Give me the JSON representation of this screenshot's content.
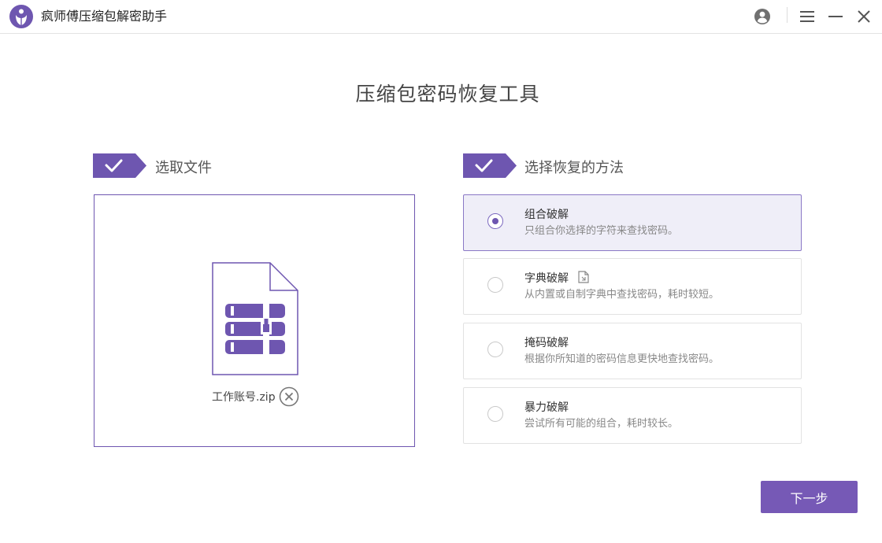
{
  "app": {
    "title": "疯师傅压缩包解密助手",
    "colors": {
      "accent": "#6e56b0",
      "button": "#7659b6",
      "selected_bg": "#efeef8"
    }
  },
  "titlebar": {
    "icons": [
      "user-icon",
      "menu-icon",
      "minimize-icon",
      "close-icon"
    ]
  },
  "page": {
    "title": "压缩包密码恢复工具"
  },
  "step1": {
    "label": "选取文件",
    "file": {
      "name": "工作账号.zip",
      "icon": "zip-file-icon"
    }
  },
  "step2": {
    "label": "选择恢复的方法",
    "methods": [
      {
        "title": "组合破解",
        "desc": "只组合你选择的字符来查找密码。",
        "selected": true
      },
      {
        "title": "字典破解",
        "desc": "从内置或自制字典中查找密码，耗时较短。",
        "selected": false,
        "extra_icon": "file-open-icon"
      },
      {
        "title": "掩码破解",
        "desc": "根据你所知道的密码信息更快地查找密码。",
        "selected": false
      },
      {
        "title": "暴力破解",
        "desc": "尝试所有可能的组合，耗时较长。",
        "selected": false
      }
    ]
  },
  "actions": {
    "next_label": "下一步"
  }
}
